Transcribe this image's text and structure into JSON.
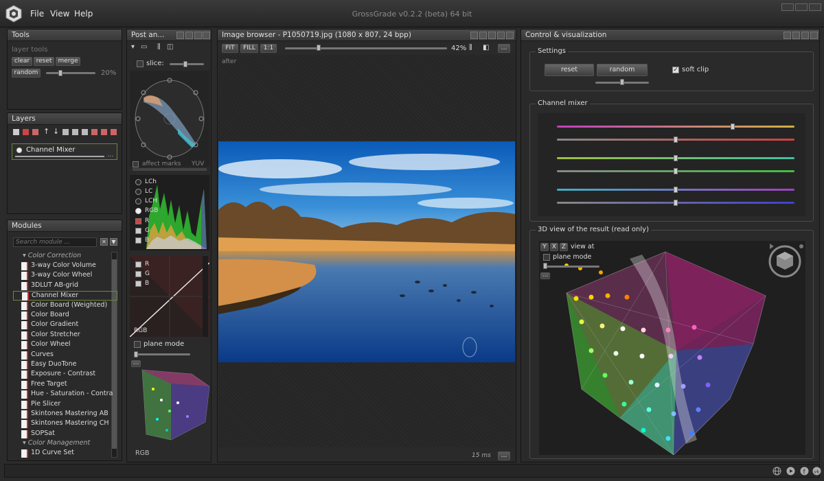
{
  "app": {
    "title": "GrossGrade v0.2.2 (beta) 64 bit",
    "menu": [
      "File",
      "View",
      "Help"
    ]
  },
  "tools": {
    "title": "Tools",
    "subtitle": "layer tools",
    "buttons": [
      "clear",
      "reset",
      "merge",
      "random"
    ],
    "random_pct": "20%"
  },
  "layers": {
    "title": "Layers",
    "items": [
      "Channel Mixer"
    ],
    "more": "..."
  },
  "modules": {
    "title": "Modules",
    "search_placeholder": "Search module ...",
    "categories": [
      {
        "name": "Color Correction",
        "items": [
          "3-way Color Volume",
          "3-way Color Wheel",
          "3DLUT AB-grid",
          "Channel Mixer",
          "Color Board (Weighted)",
          "Color Board",
          "Color Gradient",
          "Color Stretcher",
          "Color Wheel",
          "Curves",
          "Easy DuoTone",
          "Exposure - Contrast",
          "Free Target",
          "Hue - Saturation - Contra",
          "Pie Slicer",
          "Skintones Mastering AB",
          "Skintones Mastering CH",
          "SOPSat"
        ]
      },
      {
        "name": "Color Management",
        "items": [
          "1D Curve Set"
        ]
      }
    ]
  },
  "post": {
    "title": "Post an...",
    "slice_label": "slice:",
    "affect_marks": "affect marks",
    "yuv": "YUV",
    "hist_modes": [
      "LCh",
      "LC",
      "LCH",
      "RGB"
    ],
    "hist_channels": [
      "R",
      "G",
      "B"
    ],
    "curve_channels": [
      "R",
      "G",
      "B"
    ],
    "curve_label": "RGB",
    "plane_mode": "plane mode",
    "more": "...",
    "cube_label": "RGB"
  },
  "browser": {
    "title": "Image browser - P1050719.jpg (1080 x 807, 24 bpp)",
    "buttons": [
      "FIT",
      "FILL",
      "1:1"
    ],
    "zoom": "42%",
    "view_label": "after",
    "timing": "15 ms",
    "more": "..."
  },
  "control": {
    "title": "Control & visualization",
    "settings": {
      "title": "Settings",
      "reset": "reset",
      "random": "random",
      "soft_clip": "soft clip"
    },
    "mixer": {
      "title": "Channel mixer",
      "sliders": [
        {
          "from": "#c040c0",
          "to": "#d0b040",
          "value": 0.74
        },
        {
          "from": "#888888",
          "to": "#d04040",
          "value": 0.5
        },
        {
          "from": "#a0c040",
          "to": "#40c0a0",
          "value": 0.5
        },
        {
          "from": "#888888",
          "to": "#40c040",
          "value": 0.5
        },
        {
          "from": "#40b0c0",
          "to": "#a040c0",
          "value": 0.5
        },
        {
          "from": "#888888",
          "to": "#4040d0",
          "value": 0.5
        }
      ]
    },
    "view3d": {
      "title": "3D view of the result (read only)",
      "axes": [
        "Y",
        "X",
        "Z"
      ],
      "view_at": "view at",
      "plane_mode": "plane mode",
      "more": "..."
    }
  }
}
